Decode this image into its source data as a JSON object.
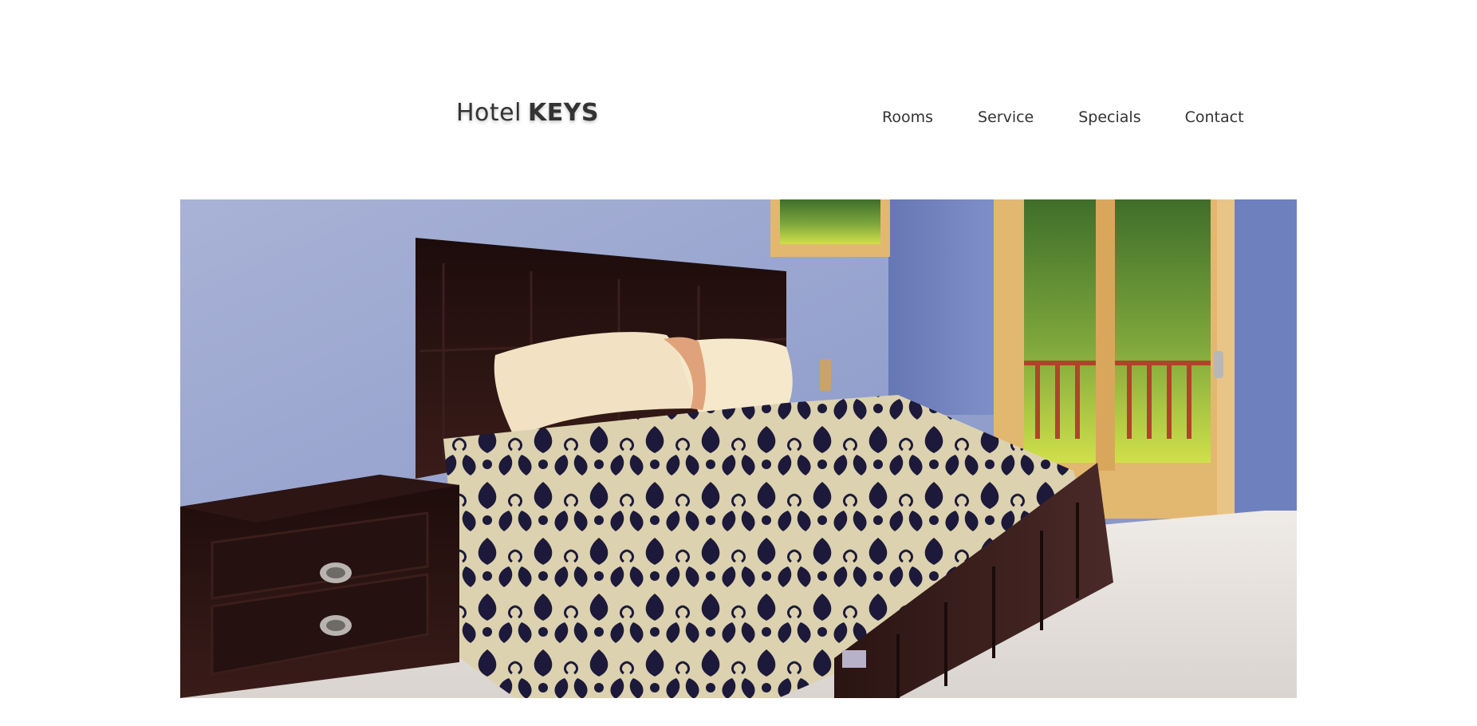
{
  "brand": {
    "name_light": "Hotel",
    "name_bold": "KEYS"
  },
  "nav": {
    "items": [
      {
        "label": "Rooms"
      },
      {
        "label": "Service"
      },
      {
        "label": "Specials"
      },
      {
        "label": "Contact"
      }
    ]
  },
  "hero": {
    "image_description": "bedroom-photo"
  },
  "colors": {
    "text": "#333333",
    "background": "#ffffff",
    "wall": "#8e9cc7",
    "wood": "#2a1412",
    "carpet": "#e6e2de",
    "foliage": "#7ea73c"
  }
}
